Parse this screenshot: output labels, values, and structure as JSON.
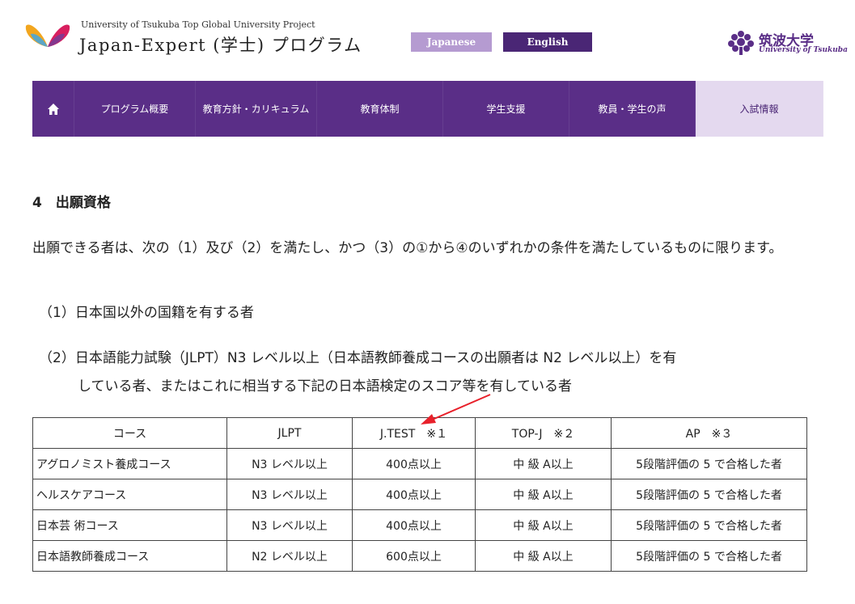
{
  "header": {
    "university_line": "University of Tsukuba Top Global University Project",
    "program_title": "Japan-Expert (学士) プログラム",
    "lang_japanese": "Japanese",
    "lang_english": "English",
    "tsukuba_jp": "筑波大学",
    "tsukuba_en": "University of Tsukuba"
  },
  "nav": {
    "items": [
      "プログラム概要",
      "教育方針・カリキュラム",
      "教育体制",
      "学生支援",
      "教員・学生の声",
      "入試情報"
    ]
  },
  "content": {
    "section_heading": "4　出願資格",
    "paragraph": "出願できる者は、次の（1）及び（2）を満たし、かつ（3）の①から④のいずれかの条件を満たしているものに限ります。",
    "item1": "（1）日本国以外の国籍を有する者",
    "item2_line1": "（2）日本語能力試験（JLPT）N3 レベル以上（日本語教師養成コースの出願者は N2 レベル以上）を有",
    "item2_line2": "している者、またはこれに相当する下記の日本語検定のスコア等を有している者"
  },
  "table": {
    "headers": [
      "コース",
      "JLPT",
      "J.TEST　※１",
      "TOP-J　※２",
      "AP　※３"
    ],
    "rows": [
      [
        "アグロノミスト養成コース",
        "N3 レベル以上",
        "400点以上",
        "中 級 A以上",
        "5段階評価の 5 で合格した者"
      ],
      [
        "ヘルスケアコース",
        "N3 レベル以上",
        "400点以上",
        "中 級 A以上",
        "5段階評価の 5 で合格した者"
      ],
      [
        "日本芸 術コース",
        "N3 レベル以上",
        "400点以上",
        "中 級 A以上",
        "5段階評価の 5 で合格した者"
      ],
      [
        "日本語教師養成コース",
        "N2 レベル以上",
        "600点以上",
        "中 級 A以上",
        "5段階評価の 5 で合格した者"
      ]
    ]
  },
  "colors": {
    "brand_purple": "#5a2e87",
    "nav_active_bg": "#e4d9ef",
    "lang_japanese_bg": "#b59bd1",
    "lang_english_bg": "#4a2675",
    "annotation_arrow": "#e8202a"
  }
}
